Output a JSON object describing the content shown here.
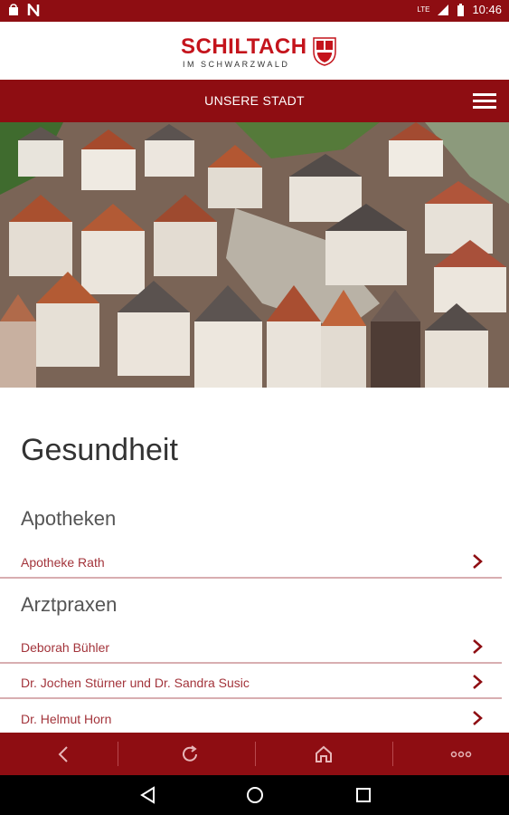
{
  "status_bar": {
    "time": "10:46",
    "signal": "LTE"
  },
  "header": {
    "logo_main": "SCHILTACH",
    "logo_sub": "IM SCHWARZWALD",
    "nav_title": "UNSERE STADT"
  },
  "colors": {
    "brand": "#8e0d12",
    "link": "#a3343b",
    "divider": "#d8aeb1"
  },
  "page": {
    "title": "Gesundheit",
    "sections": [
      {
        "heading": "Apotheken",
        "items": [
          "Apotheke Rath"
        ]
      },
      {
        "heading": "Arztpraxen",
        "items": [
          "Deborah Bühler",
          "Dr. Jochen Stürner und Dr. Sandra Susic",
          "Dr. Helmut Horn"
        ]
      }
    ]
  },
  "bottom_nav": [
    "back-icon",
    "refresh-icon",
    "home-icon",
    "more-icon"
  ],
  "system_nav": [
    "back-triangle-icon",
    "home-circle-icon",
    "recents-square-icon"
  ]
}
